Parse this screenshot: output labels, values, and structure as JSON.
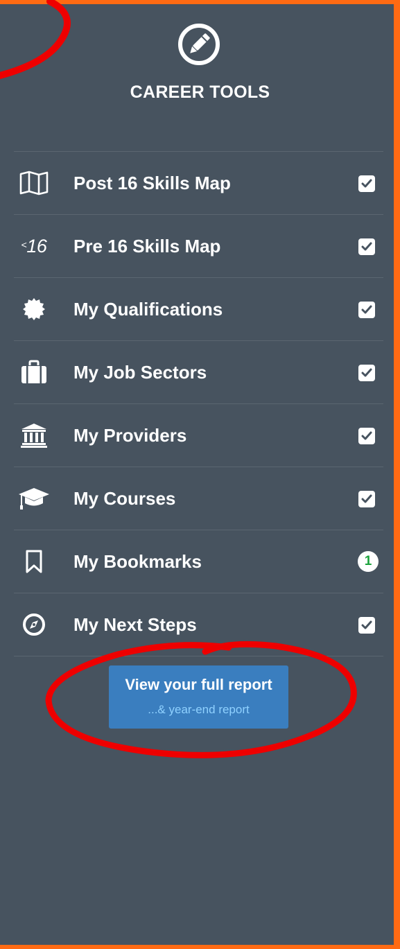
{
  "header": {
    "icon": "pencil-circle-icon",
    "title": "CAREER TOOLS"
  },
  "menu": {
    "items": [
      {
        "label": "Post 16 Skills Map",
        "icon": "folded-map-icon",
        "status": "checked"
      },
      {
        "label": "Pre 16 Skills Map",
        "icon_text": "16",
        "icon_prefix": "<",
        "status": "checked"
      },
      {
        "label": "My Qualifications",
        "icon": "certificate-seal-icon",
        "status": "checked"
      },
      {
        "label": "My Job Sectors",
        "icon": "briefcase-icon",
        "status": "checked"
      },
      {
        "label": "My Providers",
        "icon": "institution-building-icon",
        "status": "checked"
      },
      {
        "label": "My Courses",
        "icon": "graduation-cap-icon",
        "status": "checked"
      },
      {
        "label": "My Bookmarks",
        "icon": "bookmark-icon",
        "status": "count",
        "count": "1"
      },
      {
        "label": "My Next Steps",
        "icon": "compass-icon",
        "status": "checked"
      }
    ]
  },
  "report_button": {
    "label": "View your full report",
    "sublabel": "...& year-end report"
  },
  "colors": {
    "panel_bg": "#47535f",
    "border_orange": "#ff6a13",
    "button_blue": "#3a7ebf",
    "badge_green": "#1ba33c",
    "annotation_red": "#ff0000"
  }
}
